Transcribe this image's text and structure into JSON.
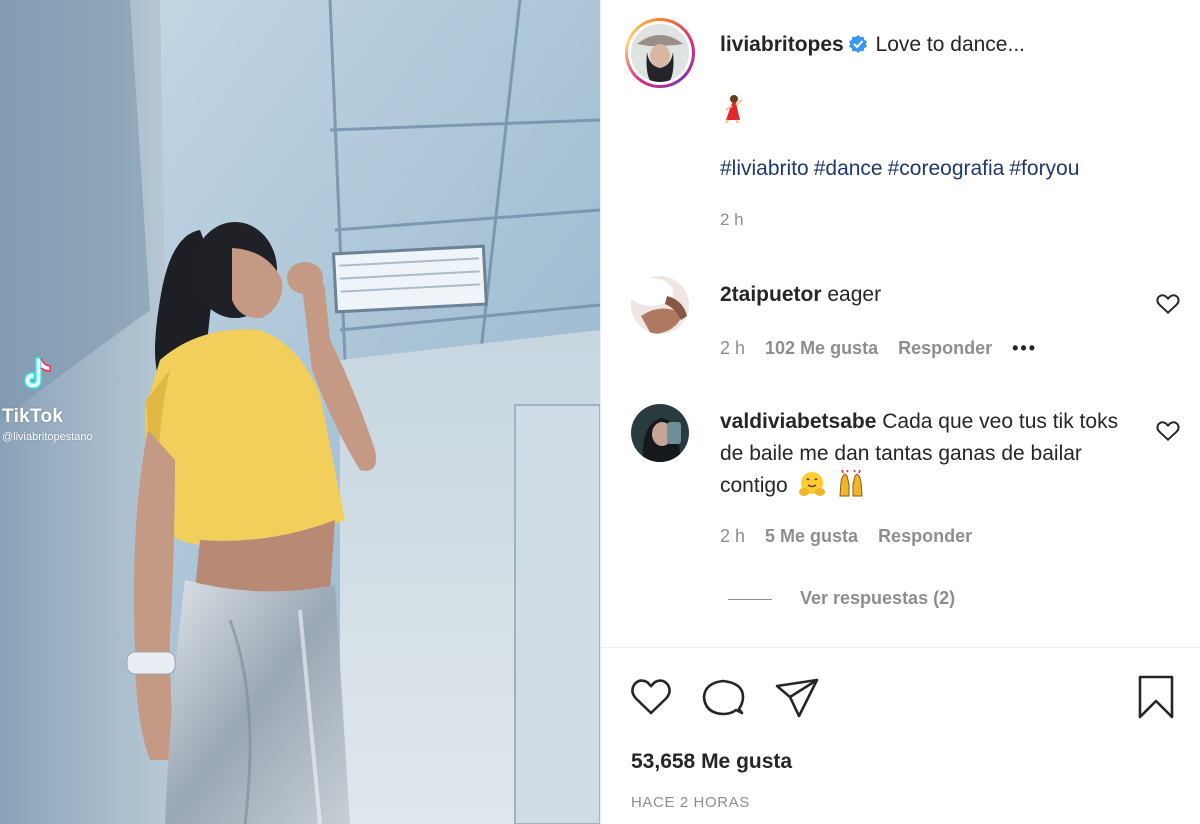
{
  "media": {
    "watermark_name": "TikTok",
    "watermark_handle": "@liviabritopestano"
  },
  "post": {
    "username": "liviabritopes",
    "caption": "Love to dance...",
    "emoji": "dancer",
    "hashtags": [
      "#liviabrito",
      "#dance",
      "#coreografia",
      "#foryou"
    ],
    "time": "2 h"
  },
  "comments": [
    {
      "username": "2taipuetor",
      "text": "eager",
      "time": "2 h",
      "likes": "102 Me gusta",
      "reply_label": "Responder",
      "more": "•••"
    },
    {
      "username": "valdiviabetsabe",
      "text": "Cada que veo tus tik toks de baile me dan tantas ganas de bailar contigo",
      "time": "2 h",
      "likes": "5 Me gusta",
      "reply_label": "Responder",
      "view_replies": "Ver respuestas (2)"
    }
  ],
  "footer": {
    "likes": "53,658 Me gusta",
    "timeago": "HACE 2 HORAS"
  },
  "icons": {
    "like": "heart-icon",
    "comment": "comment-icon",
    "share": "share-icon",
    "save": "bookmark-icon",
    "verified": "verified-badge-icon"
  },
  "colors": {
    "hashtag": "#1e3a6b",
    "verified": "#3897f0",
    "muted": "#8e8e8e"
  }
}
